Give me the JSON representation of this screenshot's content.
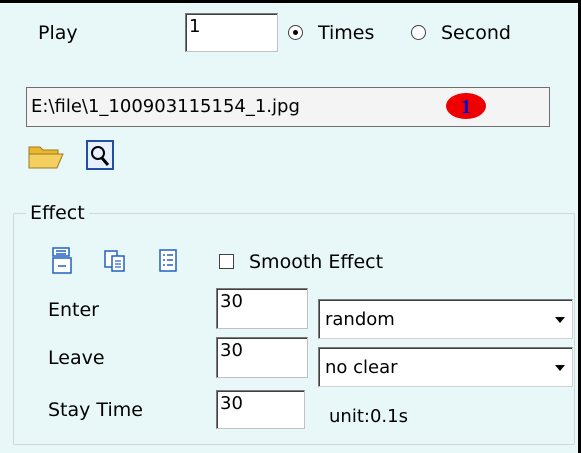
{
  "play": {
    "label": "Play",
    "count_value": "1",
    "times_label": "Times",
    "second_label": "Second",
    "selected_mode": "Times"
  },
  "file": {
    "path": "E:\\file\\1_100903115154_1.jpg",
    "badge_number": "1",
    "badge_color": "#ee0000",
    "badge_text_color": "#0000cc",
    "icons": [
      "open-folder-icon",
      "preview-magnifier-icon"
    ]
  },
  "effect": {
    "group_title": "Effect",
    "toolbar_icons": [
      "paste-effect-icon",
      "copy-effect-icon",
      "list-effect-icon"
    ],
    "smooth_label": "Smooth Effect",
    "smooth_checked": false,
    "enter": {
      "label": "Enter",
      "value": "30",
      "select_value": "random"
    },
    "leave": {
      "label": "Leave",
      "value": "30",
      "select_value": "no clear"
    },
    "stay": {
      "label": "Stay Time",
      "value": "30",
      "unit_label": "unit:0.1s"
    }
  },
  "colors": {
    "background": "#e8f8f8",
    "icon_blue": "#2060c0",
    "folder_yellow": "#f0c040"
  }
}
